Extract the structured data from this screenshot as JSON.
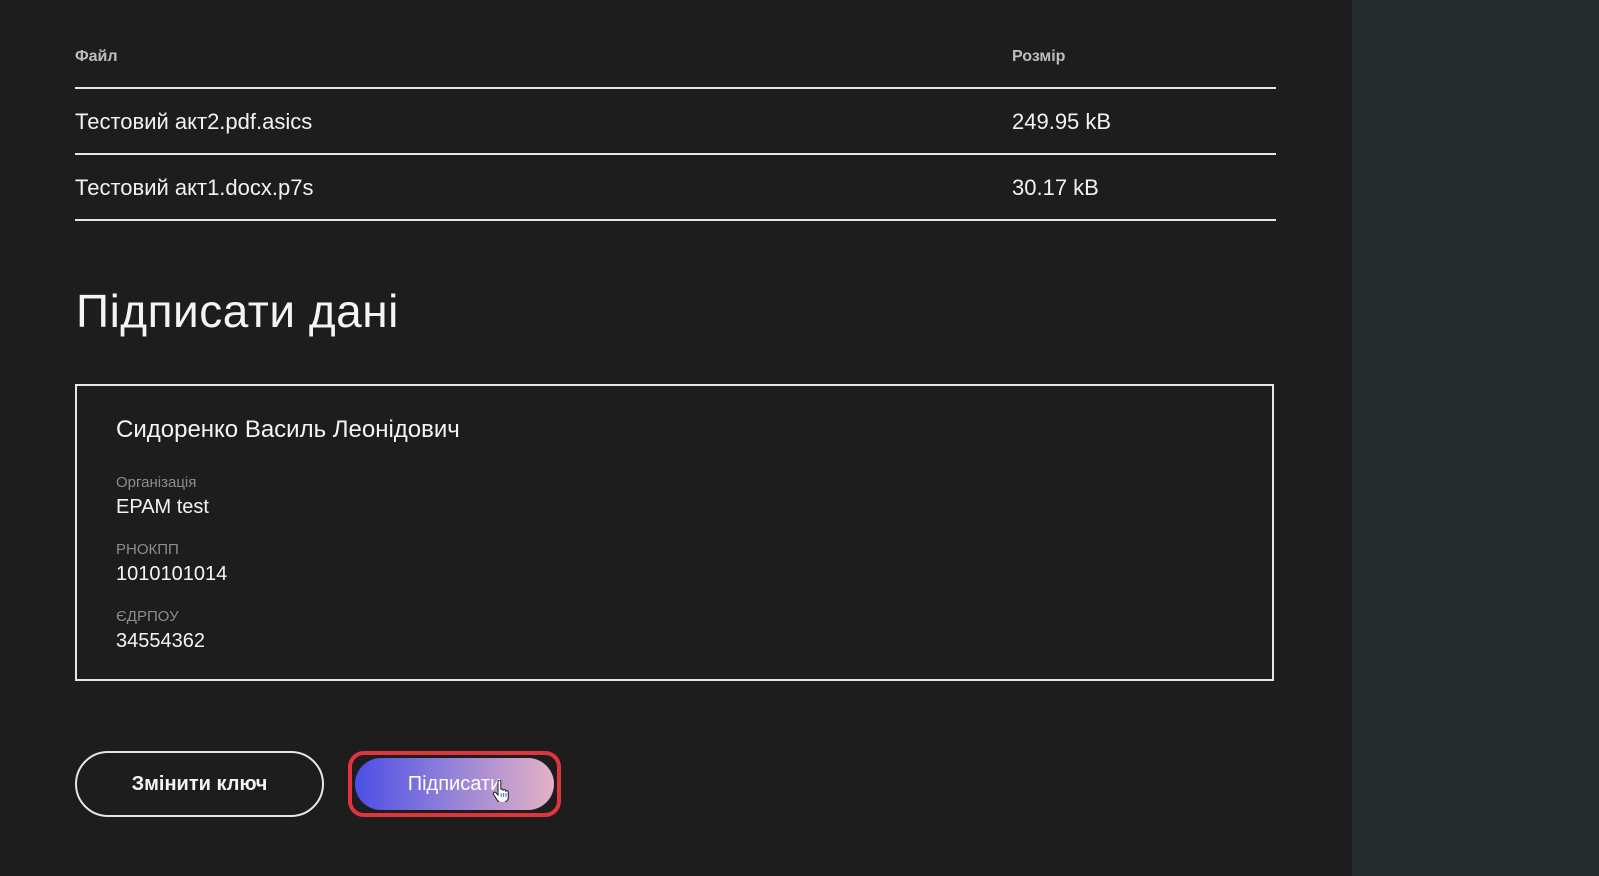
{
  "files_table": {
    "headers": {
      "name": "Файл",
      "size": "Розмір"
    },
    "rows": [
      {
        "name": "Тестовий акт2.pdf.asics",
        "size": "249.95 kB"
      },
      {
        "name": "Тестовий акт1.docx.p7s",
        "size": "30.17 kB"
      }
    ]
  },
  "sign_section": {
    "title": "Підписати дані",
    "signer": {
      "full_name": "Сидоренко Василь Леонідович",
      "organization_label": "Організація",
      "organization_value": "EPAM test",
      "rnokpp_label": "РНОКПП",
      "rnokpp_value": "1010101014",
      "edrpou_label": "ЄДРПОУ",
      "edrpou_value": "34554362"
    }
  },
  "actions": {
    "change_key_label": "Змінити ключ",
    "sign_label": "Підписати"
  },
  "icons": {
    "cursor": "hand-pointer-icon"
  },
  "colors": {
    "background": "#1d1d1e",
    "side_panel": "#252a2d",
    "highlight_border": "#e0343f",
    "sign_gradient_start": "#4b4fe6",
    "sign_gradient_end": "#e5b2c5"
  }
}
